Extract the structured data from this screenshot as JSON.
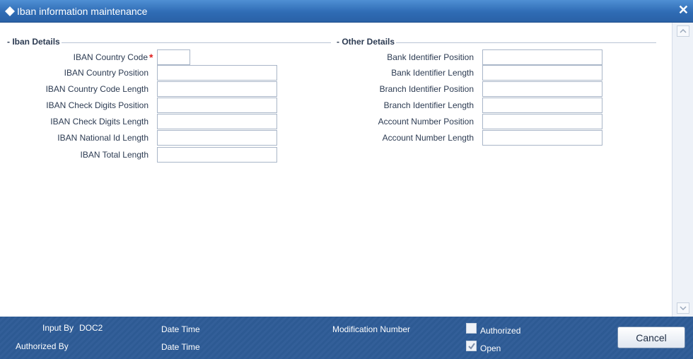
{
  "window": {
    "title": "Iban information maintenance",
    "close_glyph": "✕"
  },
  "iban_details": {
    "heading": "Iban Details",
    "fields": [
      {
        "label": "IBAN Country Code",
        "value": "",
        "required": true
      },
      {
        "label": "IBAN Country Position",
        "value": ""
      },
      {
        "label": "IBAN Country Code Length",
        "value": ""
      },
      {
        "label": "IBAN Check Digits Position",
        "value": ""
      },
      {
        "label": "IBAN Check Digits Length",
        "value": ""
      },
      {
        "label": "IBAN National Id Length",
        "value": ""
      },
      {
        "label": "IBAN Total Length",
        "value": ""
      }
    ],
    "required_marker": "*"
  },
  "other_details": {
    "heading": "Other Details",
    "fields": [
      {
        "label": "Bank Identifier Position",
        "value": ""
      },
      {
        "label": "Bank Identifier Length",
        "value": ""
      },
      {
        "label": "Branch Identifier Position",
        "value": ""
      },
      {
        "label": "Branch Identifier Length",
        "value": ""
      },
      {
        "label": "Account Number Position",
        "value": ""
      },
      {
        "label": "Account Number Length",
        "value": ""
      }
    ]
  },
  "footer": {
    "input_by_label": "Input By",
    "input_by_value": "DOC2",
    "authorized_by_label": "Authorized By",
    "date_time_label_1": "Date Time",
    "date_time_label_2": "Date Time",
    "modification_number_label": "Modification Number",
    "authorized_label": "Authorized",
    "authorized_checked": false,
    "open_label": "Open",
    "open_checked": true,
    "cancel_label": "Cancel"
  },
  "colors": {
    "titlebar": "#2f6cb5",
    "footer": "#2d5a93",
    "required": "#e02020"
  }
}
